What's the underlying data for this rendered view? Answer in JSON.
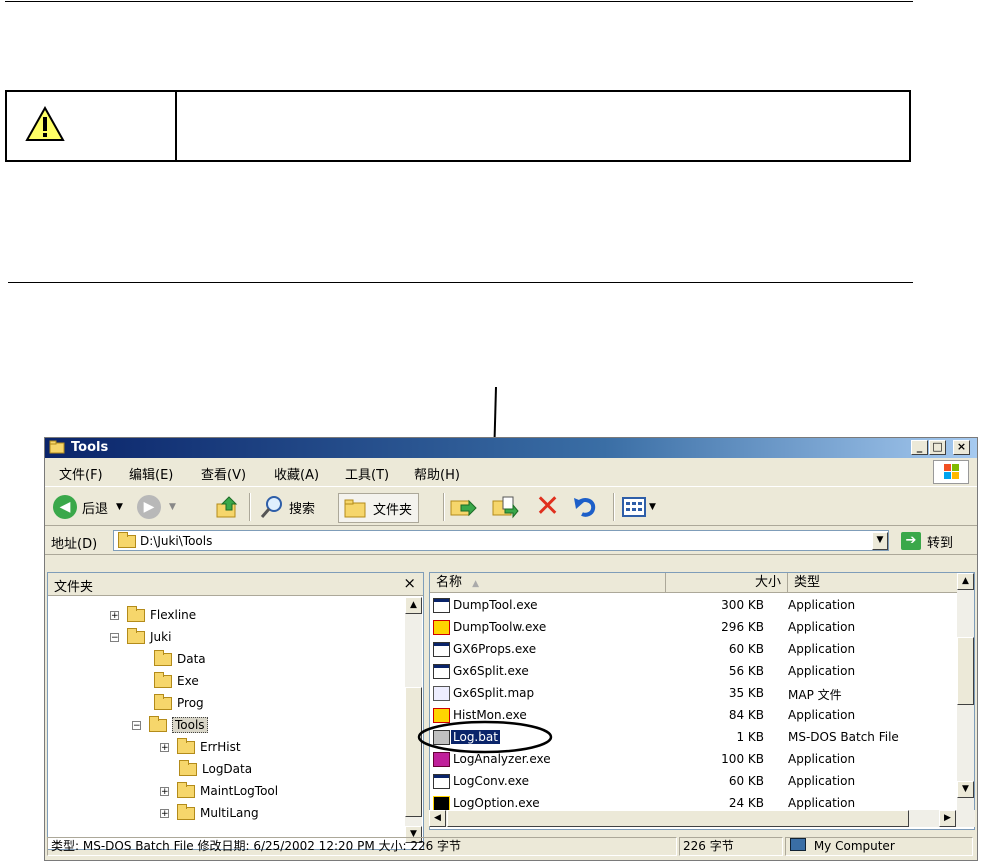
{
  "window": {
    "title": "Tools",
    "buttons": {
      "minimize": "_",
      "maximize": "□",
      "close": "×"
    }
  },
  "menu": [
    "文件(F)",
    "编辑(E)",
    "查看(V)",
    "收藏(A)",
    "工具(T)",
    "帮助(H)"
  ],
  "toolbar": {
    "back_label": "后退",
    "search_label": "搜索",
    "folders_label": "文件夹"
  },
  "address": {
    "label": "地址(D)",
    "value": "D:\\Juki\\Tools",
    "go_label": "转到"
  },
  "folder_pane": {
    "title": "文件夹",
    "close": "×",
    "tree": [
      {
        "label": "Flexline",
        "expander": "+"
      },
      {
        "label": "Juki",
        "expander": "−"
      },
      {
        "label": "Data",
        "expander": ""
      },
      {
        "label": "Exe",
        "expander": ""
      },
      {
        "label": "Prog",
        "expander": ""
      },
      {
        "label": "Tools",
        "expander": "−"
      },
      {
        "label": "ErrHist",
        "expander": "+"
      },
      {
        "label": "LogData",
        "expander": ""
      },
      {
        "label": "MaintLogTool",
        "expander": "+"
      },
      {
        "label": "MultiLang",
        "expander": "+"
      }
    ]
  },
  "columns": {
    "name": "名称",
    "size": "大小",
    "type": "类型"
  },
  "files": [
    {
      "name": "DumpTool.exe",
      "size": "300 KB",
      "type": "Application"
    },
    {
      "name": "DumpToolw.exe",
      "size": "296 KB",
      "type": "Application"
    },
    {
      "name": "GX6Props.exe",
      "size": "60 KB",
      "type": "Application"
    },
    {
      "name": "Gx6Split.exe",
      "size": "56 KB",
      "type": "Application"
    },
    {
      "name": "Gx6Split.map",
      "size": "35 KB",
      "type": "MAP 文件"
    },
    {
      "name": "HistMon.exe",
      "size": "84 KB",
      "type": "Application"
    },
    {
      "name": "Log.bat",
      "size": "1 KB",
      "type": "MS-DOS Batch File"
    },
    {
      "name": "LogAnalyzer.exe",
      "size": "100 KB",
      "type": "Application"
    },
    {
      "name": "LogConv.exe",
      "size": "60 KB",
      "type": "Application"
    },
    {
      "name": "LogOption.exe",
      "size": "24 KB",
      "type": "Application"
    }
  ],
  "status": {
    "info": "类型: MS-DOS Batch File 修改日期: 6/25/2002 12:20 PM 大小: 226 字节",
    "size": "226 字节",
    "zone": "My Computer"
  },
  "colors": {
    "title_bar": "#0a246a",
    "selection": "#0a246a",
    "chrome": "#ece9d8"
  }
}
